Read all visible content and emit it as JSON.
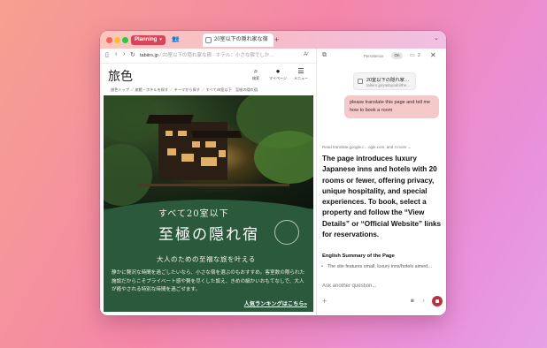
{
  "browser": {
    "space_label": "Planning",
    "tab_title": "20室以下の隠れ家な宿",
    "url_host": "tabiiro.jp",
    "url_path": "/ 20室以下の隠れ家な宿 · ホテル：小さな宿でしか…"
  },
  "site": {
    "logo": "旅色",
    "search_label": "検索",
    "mypage_label": "マイページ",
    "menu_label": "メニュー",
    "breadcrumb": "旅色トップ ／ 旅館・ホテルを探す ／ テーマから探す ／ すべて20室以下　至極の隠れ宿",
    "hero_sub": "すべて20室以下",
    "hero_title": "至極の隠れ宿",
    "hero_lead": "大人のための至福な旅を叶える",
    "hero_body": "静かに贅沢な時間を過ごしたいなら、小さな宿を選ぶのもおすすめ。客室数の限られた施設だからこそプライベート感や贅を尽くした設え、きめの細かいおもてなしで、大人が癒やされる特別な時間を過ごせます。",
    "hero_link": "人気ランキングはこちら»"
  },
  "panel": {
    "persistence_label": "Persistence",
    "toggle_label": "On",
    "tab_count": "2",
    "context_title": "20室以下の隠れ家…",
    "context_url": "tabiiro.jp/yadoyado/the…",
    "user_message": "please translate this page and tell me how to book a room",
    "read_line": "Read translate.google.c…ogle.com, and 4 more ⌄",
    "answer": "The page introduces luxury Japanese inns and hotels with 20 rooms or fewer, offering privacy, unique hospitality, and special experiences. To book, select a property and follow the “View Details” or “Official Website” links for reservations.",
    "summary_heading": "English Summary of the Page",
    "summary_item_1": "The site features small, luxury inns/hotels aimed…",
    "input_placeholder": "Ask another question..."
  },
  "colors": {
    "space_pill": "#d7455b",
    "user_bubble": "#f6c9c9",
    "stop_button": "#b8323f",
    "hero_green": "#2a5a3b"
  }
}
